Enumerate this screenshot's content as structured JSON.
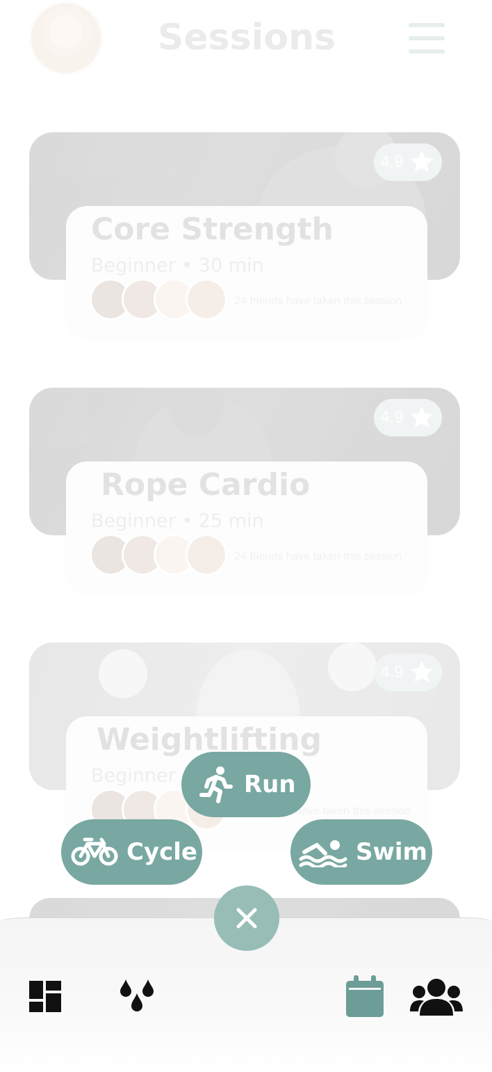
{
  "header": {
    "title": "Sessions"
  },
  "sessions": [
    {
      "name": "Core Strength",
      "meta": "Beginner • 30 min",
      "rating": "4.9",
      "friends_text": "24 friends have taken this session"
    },
    {
      "name": "Rope Cardio",
      "meta": "Beginner • 25 min",
      "rating": "4.9",
      "friends_text": "24 friends have taken this session"
    },
    {
      "name": "Weightlifting",
      "meta": "Beginner",
      "rating": "4.9",
      "friends_text": "have taken this session"
    }
  ],
  "actions": {
    "run_label": "Run",
    "cycle_label": "Cycle",
    "swim_label": "Swim"
  },
  "tab_bar": {
    "items": [
      {
        "icon": "dashboard-icon"
      },
      {
        "icon": "drops-icon"
      },
      {
        "icon": "calendar-icon",
        "active": true
      },
      {
        "icon": "group-icon"
      }
    ]
  },
  "colors": {
    "accent": "#78a8a1",
    "accent_light": "#97bdb6",
    "calendar_active": "#6c9d97",
    "tab_icon": "#111111"
  }
}
